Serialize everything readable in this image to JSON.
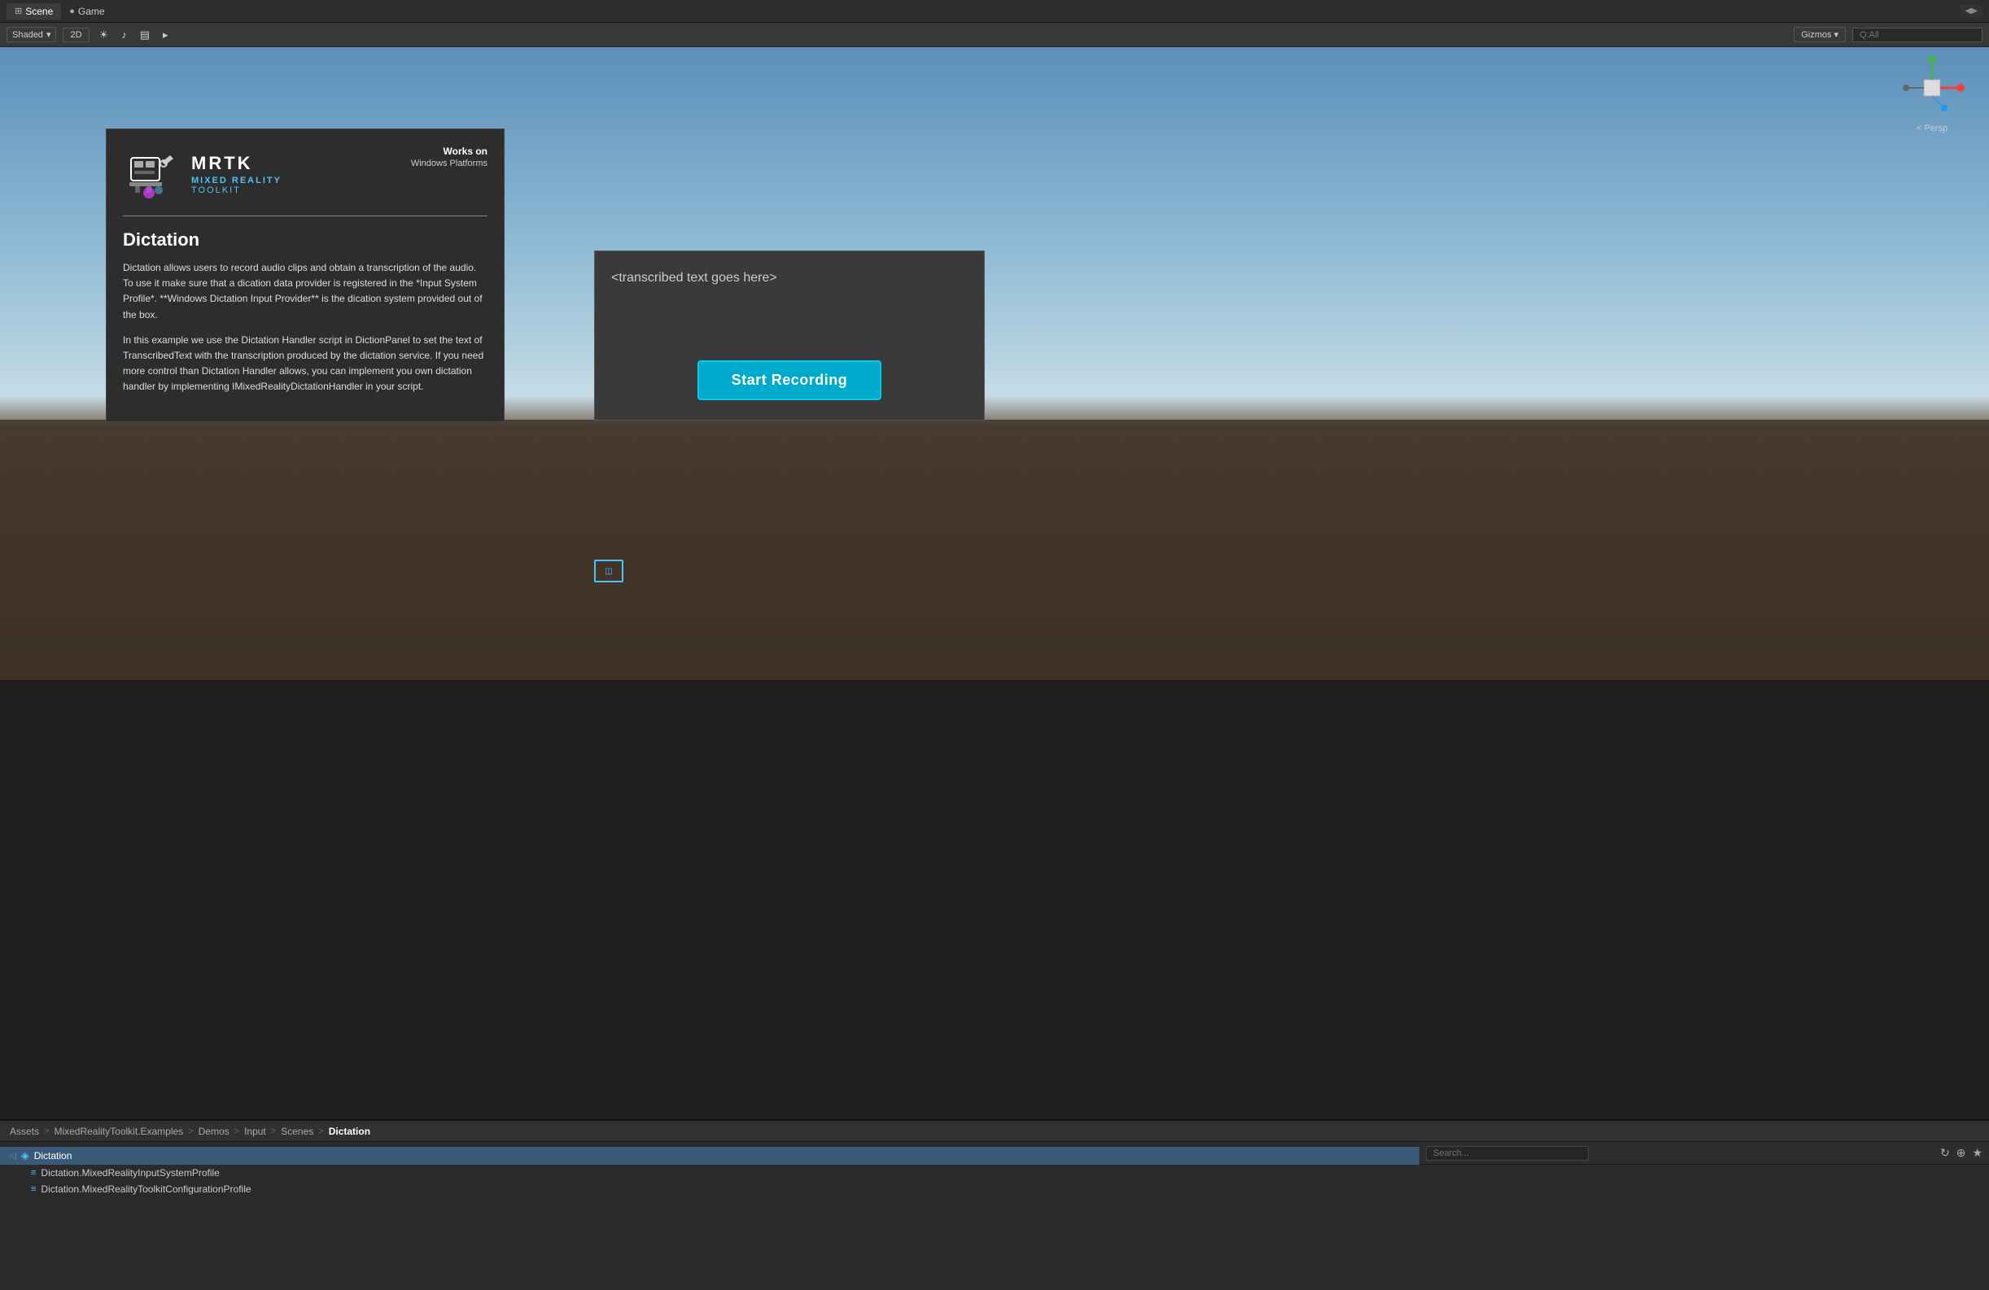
{
  "tabs": {
    "scene_label": "Scene",
    "game_label": "Game",
    "scene_icon": "⊞",
    "game_icon": "●"
  },
  "scene_toolbar": {
    "shading_label": "Shaded",
    "mode_2d": "2D",
    "sun_icon": "☀",
    "audio_icon": "♪",
    "layers_icon": "▤",
    "gizmos_label": "Gizmos",
    "gizmos_arrow": "▾",
    "search_placeholder": "Q:All",
    "collapse_icon": "◀▶"
  },
  "gizmo": {
    "label": "Persp",
    "arrow_label": "< Persp"
  },
  "mrtk_panel": {
    "logo_letters": "MRTK",
    "subtitle_line1": "MIXED REALITY",
    "subtitle_line2": "TOOLKIT",
    "works_on_label": "Works on",
    "platform": "Windows Platforms",
    "feature_title": "Dictation",
    "body_para1": "Dictation allows users to record audio clips and obtain a transcription of the audio. To use it make sure that a dication data provider is registered in the *Input System Profile*. **Windows Dictation Input Provider** is the dication system provided out of the box.",
    "body_para2": "In this example we use the Dictation Handler script in DictionPanel to set the text of TranscribedText with the transcription produced by the dictation service. If you need more control than Dictation Handler allows, you can implement you own dictation handler by implementing IMixedRealityDictationHandler in your script."
  },
  "transcription_panel": {
    "placeholder_text": "<transcribed text goes here>",
    "start_recording_label": "Start Recording"
  },
  "floating_icon": {
    "label": "[]"
  },
  "breadcrumb": {
    "assets": "Assets",
    "sep1": ">",
    "toolkit_examples": "MixedRealityToolkit.Examples",
    "sep2": ">",
    "demos": "Demos",
    "sep3": ">",
    "input": "Input",
    "sep4": ">",
    "scenes": "Scenes",
    "sep5": ">",
    "active": "Dictation"
  },
  "asset_tree": {
    "items": [
      {
        "label": "Dictation",
        "indent": 0,
        "selected": true,
        "icon": "◁",
        "type": "scene"
      },
      {
        "label": "Dictation.MixedRealityInputSystemProfile",
        "indent": 1,
        "selected": false,
        "icon": "≡",
        "type": "profile"
      },
      {
        "label": "Dictation.MixedRealityToolkitConfigurationProfile",
        "indent": 1,
        "selected": false,
        "icon": "≡",
        "type": "profile"
      }
    ]
  },
  "bottom_icons": {
    "icon1": "↻",
    "icon2": "⊕",
    "icon3": "★"
  },
  "colors": {
    "accent_cyan": "#4fc3f7",
    "recording_btn": "#00aacc",
    "recording_btn_border": "#00ccee",
    "selected_row": "#3a5a7a",
    "toolbar_bg": "#383838",
    "panel_bg": "#2d2d2d",
    "scene_bg_top": "#5b8fba",
    "scene_bg_mid": "#b8d4e0",
    "scene_bg_ground": "#6b5a4a"
  }
}
